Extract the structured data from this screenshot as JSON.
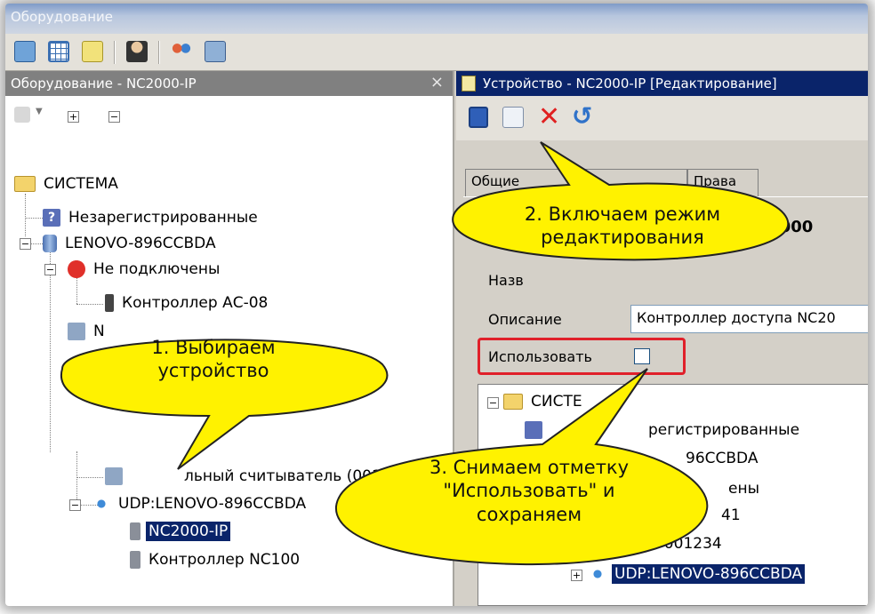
{
  "window": {
    "title": "Оборудование"
  },
  "left_pane": {
    "title": "Оборудование - NC2000-IP",
    "close_glyph": "×",
    "toolbar": {
      "expand": "+",
      "collapse": "−"
    },
    "tree": [
      {
        "label": "СИСТЕМА",
        "icon": "folder-icon"
      },
      {
        "label": "Незарегистрированные",
        "icon": "question-icon"
      },
      {
        "label": "LENOVO-896CCBDA",
        "icon": "database-icon"
      },
      {
        "label": "Не подключены",
        "icon": "no-entry-icon"
      },
      {
        "label": "Контроллер АС-08",
        "icon": "controller-icon"
      },
      {
        "label": "N",
        "icon": "reader-icon"
      },
      {
        "label": "льный считыватель (001",
        "icon": "reader-icon"
      },
      {
        "label": "UDP:LENOVO-896CCBDA",
        "icon": "network-icon"
      },
      {
        "label": "NC2000-IP",
        "icon": "controller-icon",
        "selected": true
      },
      {
        "label": "Контроллер NC100",
        "icon": "controller-icon"
      }
    ]
  },
  "right_pane": {
    "title": "Устройство - NC2000-IP [Редактирование]",
    "tabs": [
      "Общие",
      "Права"
    ],
    "device_title": "C2000",
    "name_label": "Назв",
    "description_label": "Описание",
    "description_value": "Контроллер доступа NC20",
    "use_label": "Использовать",
    "use_checked": false,
    "tree": [
      {
        "label": "СИСТЕ",
        "icon": "folder-icon"
      },
      {
        "label": "регистрированные",
        "icon": "question-icon"
      },
      {
        "label": "96CCBDA",
        "icon": "database-icon"
      },
      {
        "label": "ены",
        "icon": "no-entry-icon"
      },
      {
        "label": "41",
        "icon": "controller-icon"
      },
      {
        "label": ". 001234",
        "icon": "reader-icon"
      },
      {
        "label": "UDP:LENOVO-896CCBDA",
        "icon": "network-icon",
        "selected": true
      }
    ]
  },
  "callouts": {
    "step1": {
      "line1": "1. Выбираем",
      "line2": "устройство"
    },
    "step2": {
      "line1": "2. Включаем режим",
      "line2": "редактирования"
    },
    "step3": {
      "line1": "3. Снимаем отметку",
      "line2": "\"Использовать\" и",
      "line3": "сохраняем"
    }
  },
  "colors": {
    "selection": "#0a246a",
    "callout_fill": "#fff200",
    "highlight_border": "#e0202a"
  }
}
